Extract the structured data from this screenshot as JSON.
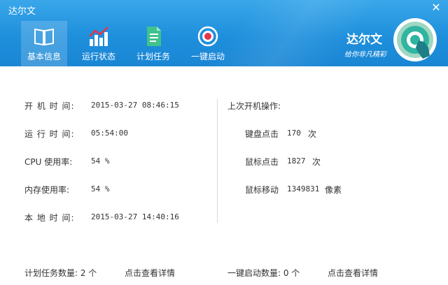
{
  "window": {
    "title": "达尔文",
    "close_glyph": "✕"
  },
  "toolbar": [
    {
      "label": "基本信息",
      "icon": "book-icon",
      "active": true
    },
    {
      "label": "运行状态",
      "icon": "bar-chart-icon",
      "active": false
    },
    {
      "label": "计划任务",
      "icon": "document-icon",
      "active": false
    },
    {
      "label": "一键启动",
      "icon": "power-target-icon",
      "active": false
    }
  ],
  "brand": {
    "name": "达尔文",
    "slogan": "给你非凡精彩"
  },
  "info": [
    {
      "label": "开 机 时 间:",
      "value": "2015-03-27 08:46:15"
    },
    {
      "label": "运 行 时 间:",
      "value": "05:54:00"
    },
    {
      "label": "CPU  使用率:",
      "value": "54 %"
    },
    {
      "label": "内存使用率:",
      "value": "54 %"
    },
    {
      "label": "本 地 时 间:",
      "value": "2015-03-27 14:40:16"
    }
  ],
  "last_op": {
    "title": "上次开机操作:",
    "items": [
      {
        "label": "键盘点击",
        "value": "170",
        "unit": "次"
      },
      {
        "label": "鼠标点击",
        "value": "1827",
        "unit": "次"
      },
      {
        "label": "鼠标移动",
        "value": "1349831",
        "unit": "像素"
      }
    ]
  },
  "footer": {
    "tasks_label": "计划任务数量: 2 个",
    "tasks_link": "点击查看详情",
    "startup_label": "一键启动数量: 0 个",
    "startup_link": "点击查看详情"
  },
  "colors": {
    "header": "#1e8fdc",
    "accent_red": "#e8334a",
    "accent_green": "#3fc28c"
  }
}
